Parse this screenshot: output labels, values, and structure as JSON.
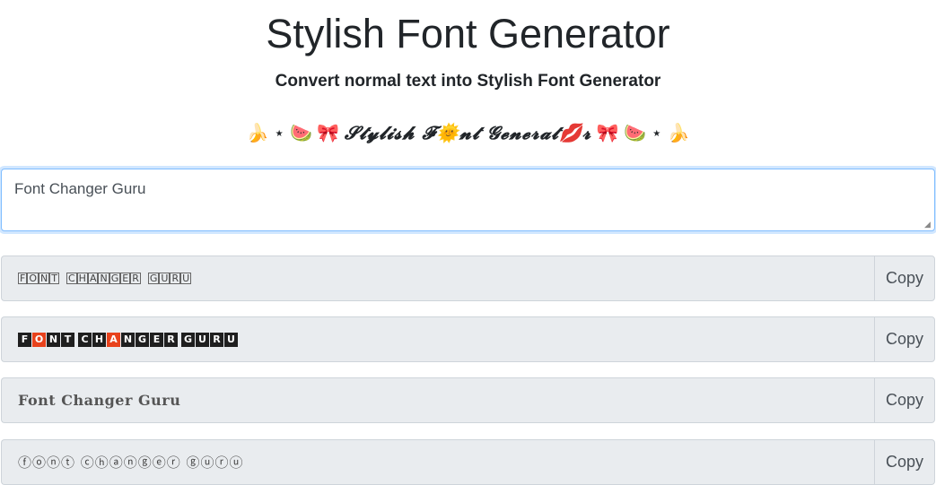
{
  "header": {
    "title": "Stylish Font Generator",
    "subtitle": "Convert normal text into Stylish Font Generator",
    "decor_left": "🍌 ⋆ 🍉 🎀",
    "decor_text": "𝓢𝓽𝔂𝓵𝓲𝓼𝓱 𝓕🌞𝓷𝓽 𝓖𝓮𝓷𝓮𝓻𝓪𝓽💋𝓻",
    "decor_right": "🎀 🍉 ⋆ 🍌"
  },
  "input": {
    "value": "Font Changer Guru"
  },
  "results": [
    {
      "text": "🄵🄾🄽🅃 🄲🄷🄰🄽🄶🄴🅁 🄶🅄🅁🅄",
      "copy_label": "Copy"
    },
    {
      "text": "FONT CHANGER GURU",
      "copy_label": "Copy"
    },
    {
      "text": "Font Changer Guru",
      "copy_label": "Copy"
    },
    {
      "text": "ⓕⓞⓝⓣ ⓒⓗⓐⓝⓖⓔⓡ ⓖⓤⓡⓤ",
      "copy_label": "Copy"
    }
  ],
  "colors": {
    "highlight_square": "#e8421c",
    "field_bg": "#e9ecef",
    "focus_border": "#80bdff"
  }
}
